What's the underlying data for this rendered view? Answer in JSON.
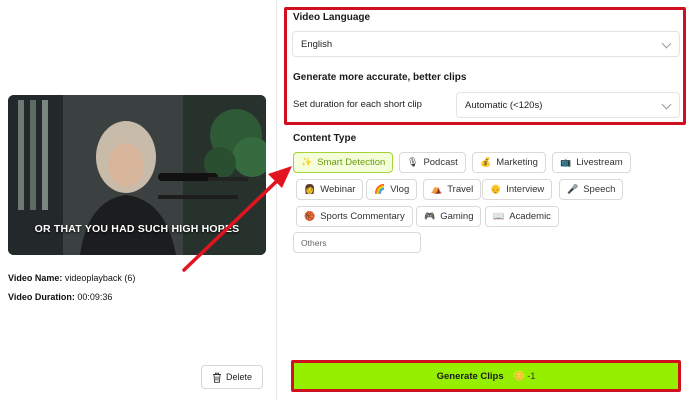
{
  "video": {
    "caption": "OR THAT YOU HAD SUCH HIGH HOPES",
    "name_label": "Video Name:",
    "name_value": "videoplayback (6)",
    "duration_label": "Video Duration:",
    "duration_value": "00:09:36",
    "delete_label": "Delete"
  },
  "settings": {
    "language_title": "Video Language",
    "language_value": "English",
    "clips_title": "Generate more accurate, better clips",
    "duration_label": "Set duration for each short clip",
    "duration_value": "Automatic (<120s)"
  },
  "content_type": {
    "title": "Content Type",
    "options": [
      {
        "label": "Smart Detection",
        "icon": "sparkle-icon"
      },
      {
        "label": "Podcast",
        "icon": "microphone-icon"
      },
      {
        "label": "Marketing",
        "icon": "money-bag-icon"
      },
      {
        "label": "Livestream",
        "icon": "tv-icon"
      },
      {
        "label": "Webinar",
        "icon": "person-icon"
      },
      {
        "label": "Vlog",
        "icon": "rainbow-icon"
      },
      {
        "label": "Travel",
        "icon": "tent-icon"
      },
      {
        "label": "Interview",
        "icon": "person-icon"
      },
      {
        "label": "Speech",
        "icon": "microphone-icon"
      },
      {
        "label": "Sports Commentary",
        "icon": "basketball-icon"
      },
      {
        "label": "Gaming",
        "icon": "gamepad-icon"
      },
      {
        "label": "Academic",
        "icon": "book-icon"
      },
      {
        "label": "Others",
        "icon": ""
      }
    ]
  },
  "generate": {
    "label": "Generate Clips",
    "credit": "-1"
  },
  "colors": {
    "accent_green": "#97ef00",
    "highlight_red": "#d0101e"
  }
}
